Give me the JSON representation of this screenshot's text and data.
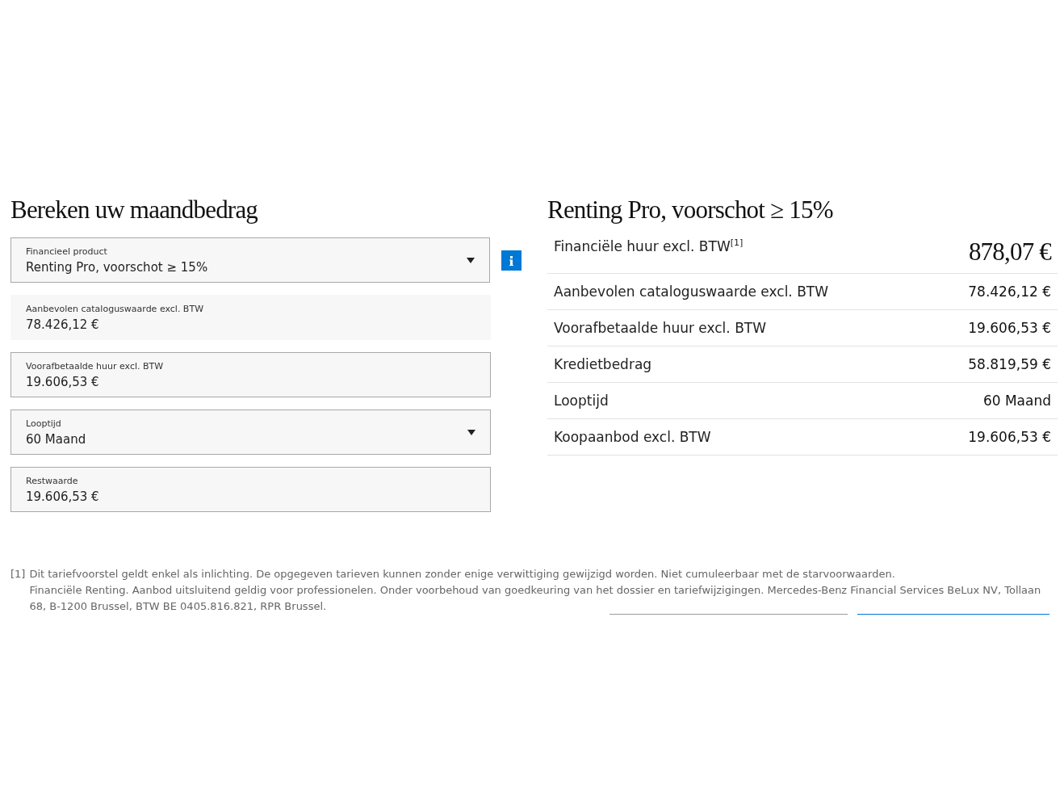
{
  "calculator": {
    "title": "Bereken uw maandbedrag",
    "fields": [
      {
        "kind": "select",
        "label": "Financieel product",
        "value": "Renting Pro, voorschot ≥ 15%",
        "info": true
      },
      {
        "kind": "readonly",
        "label": "Aanbevolen cataloguswaarde excl. BTW",
        "value": "78.426,12 €",
        "info": false
      },
      {
        "kind": "input",
        "label": "Voorafbetaalde huur excl. BTW",
        "value": "19.606,53 €",
        "info": false
      },
      {
        "kind": "select",
        "label": "Looptijd",
        "value": "60 Maand",
        "info": false
      },
      {
        "kind": "input",
        "label": "Restwaarde",
        "value": "19.606,53 €",
        "info": false
      }
    ]
  },
  "summary": {
    "title": "Renting Pro, voorschot ≥ 15%",
    "rows": [
      {
        "kind": "main",
        "label": "Financiële huur excl. BTW$^{[1]}$",
        "value": "878,07 €"
      },
      {
        "kind": "plain",
        "label": "Aanbevolen cataloguswaarde excl. BTW",
        "value": "78.426,12 €"
      },
      {
        "kind": "plain",
        "label": "Voorafbetaalde huur excl. BTW",
        "value": "19.606,53 €"
      },
      {
        "kind": "plain",
        "label": "Kredietbedrag",
        "value": "58.819,59 €"
      },
      {
        "kind": "plain",
        "label": "Looptijd",
        "value": "60 Maand"
      },
      {
        "kind": "plain",
        "label": "Koopaanbod excl. BTW",
        "value": "19.606,53 €"
      }
    ]
  },
  "footnote": {
    "marker": "[1]",
    "paragraphs": [
      "Dit tariefvoorstel geldt enkel als inlichting. De opgegeven tarieven kunnen zonder enige verwittiging gewijzigd worden. Niet cumuleerbaar met de starvoorwaarden.",
      "Financiële Renting. Aanbod uitsluitend geldig voor professionelen. Onder voorbehoud van goedkeuring van het dossier en tariefwijzigingen. Mercedes-Benz Financial Services BeLux NV, Tollaan 68, B-1200 Brussel, BTW BE 0405.816.821, RPR Brussel."
    ]
  }
}
